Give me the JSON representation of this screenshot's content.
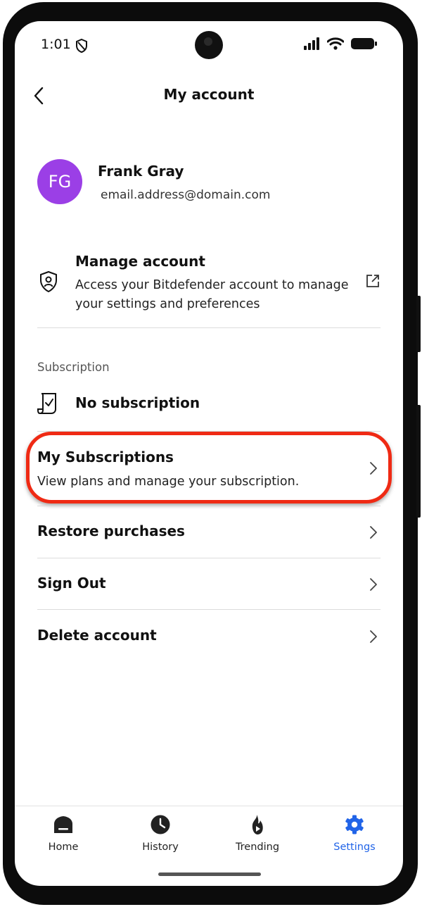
{
  "status_bar": {
    "time": "1:01"
  },
  "header": {
    "title": "My account",
    "back_icon": "back-arrow-icon"
  },
  "profile": {
    "initials": "FG",
    "name": "Frank Gray",
    "email": "email.address@domain.com",
    "avatar_color": "#9b3fe6"
  },
  "manage_account": {
    "title": "Manage account",
    "description": "Access your Bitdefender account to manage your settings and preferences"
  },
  "subscription": {
    "section_label": "Subscription",
    "status": "No subscription"
  },
  "menu": [
    {
      "title": "My Subscriptions",
      "description": "View plans and manage your subscription."
    },
    {
      "title": "Restore purchases"
    },
    {
      "title": "Sign Out"
    },
    {
      "title": "Delete account"
    }
  ],
  "highlight_color": "#ef2a14",
  "bottom_nav": {
    "items": [
      {
        "label": "Home",
        "icon": "home-icon"
      },
      {
        "label": "History",
        "icon": "history-clock-icon"
      },
      {
        "label": "Trending",
        "icon": "trending-flame-icon"
      },
      {
        "label": "Settings",
        "icon": "settings-gear-icon",
        "active": true
      }
    ],
    "active_color": "#2164e8"
  }
}
